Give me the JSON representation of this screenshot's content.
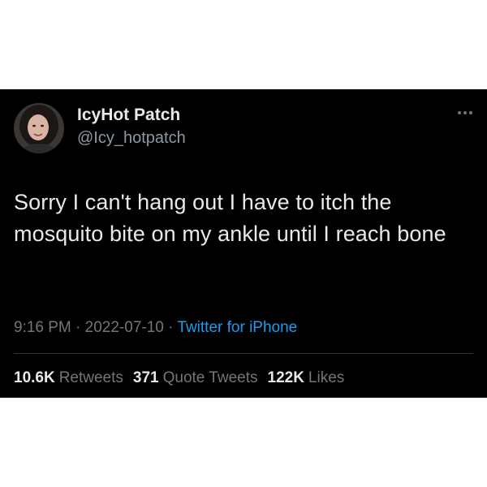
{
  "author": {
    "display_name": "IcyHot Patch",
    "handle": "@Icy_hotpatch"
  },
  "tweet": {
    "text": "Sorry I can't hang out I have to itch the mosquito bite on my ankle until I reach bone",
    "time": "9:16 PM",
    "separator": "·",
    "date": "2022-07-10",
    "source": "Twitter for iPhone"
  },
  "stats": {
    "retweets_count": "10.6K",
    "retweets_label": "Retweets",
    "quote_tweets_count": "371",
    "quote_tweets_label": "Quote Tweets",
    "likes_count": "122K",
    "likes_label": "Likes"
  },
  "icons": {
    "more": "more-horizontal-icon",
    "avatar": "profile-photo"
  },
  "colors": {
    "background": "#000000",
    "text": "#e7e9ea",
    "secondary": "#71767b",
    "link": "#1d9bf0"
  }
}
